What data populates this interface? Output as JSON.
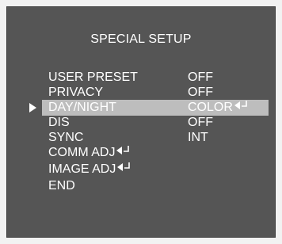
{
  "menu": {
    "title": "SPECIAL SETUP",
    "selected_index": 2,
    "items": [
      {
        "label": "USER PRESET",
        "value": "OFF",
        "submenu": false
      },
      {
        "label": "PRIVACY",
        "value": "OFF",
        "submenu": false
      },
      {
        "label": "DAY/NIGHT",
        "value": "COLOR",
        "submenu": true
      },
      {
        "label": "DIS",
        "value": "OFF",
        "submenu": false
      },
      {
        "label": "SYNC",
        "value": "INT",
        "submenu": false
      },
      {
        "label": "COMM ADJ",
        "value": "",
        "submenu": true
      },
      {
        "label": "IMAGE ADJ",
        "value": "",
        "submenu": true
      },
      {
        "label": "END",
        "value": "",
        "submenu": false
      }
    ]
  },
  "colors": {
    "background": "#555555",
    "text": "#ffffff",
    "highlight": "#bdbdbd"
  },
  "icons": {
    "cursor": "right-triangle-icon",
    "submenu": "enter-arrow-icon"
  }
}
